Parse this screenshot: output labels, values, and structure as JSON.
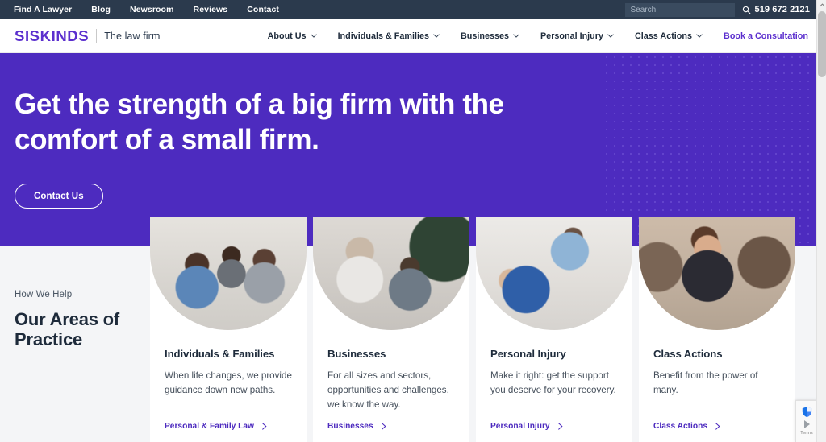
{
  "topbar": {
    "links": [
      {
        "label": "Find A Lawyer",
        "active": false
      },
      {
        "label": "Blog",
        "active": false
      },
      {
        "label": "Newsroom",
        "active": false
      },
      {
        "label": "Reviews",
        "active": true
      },
      {
        "label": "Contact",
        "active": false
      }
    ],
    "search_placeholder": "Search",
    "search_value": "",
    "phone": "519 672 2121",
    "bg_color": "#2b3a4d"
  },
  "header": {
    "logo_mark": "SISKINDS",
    "logo_tagline": "The law firm",
    "nav": [
      {
        "label": "About Us",
        "has_dropdown": true
      },
      {
        "label": "Individuals & Families",
        "has_dropdown": true
      },
      {
        "label": "Businesses",
        "has_dropdown": true
      },
      {
        "label": "Personal Injury",
        "has_dropdown": true
      },
      {
        "label": "Class Actions",
        "has_dropdown": true
      }
    ],
    "cta_label": "Book a Consultation",
    "accent_color": "#5b2fce"
  },
  "hero": {
    "title": "Get the strength of a big firm with the comfort of a small firm.",
    "button_label": "Contact Us",
    "bg_color": "#4d2bbf"
  },
  "practice": {
    "eyebrow": "How We Help",
    "title": "Our Areas of Practice",
    "cards": [
      {
        "title": "Individuals & Families",
        "description": "When life changes, we provide guidance down new paths.",
        "link_label": "Personal & Family Law",
        "image_alt": "three colleagues looking at a laptop at a table"
      },
      {
        "title": "Businesses",
        "description": "For all sizes and sectors, opportunities and challenges, we know the way.",
        "link_label": "Businesses",
        "image_alt": "woman presenting to colleagues in a meeting room"
      },
      {
        "title": "Personal Injury",
        "description": "Make it right: get the support you deserve for your recovery.",
        "link_label": "Personal Injury",
        "image_alt": "physiotherapist treating a patient's leg"
      },
      {
        "title": "Class Actions",
        "description": "Benefit from the power of many.",
        "link_label": "Class Actions",
        "image_alt": "lawyer in a courtroom holding documents"
      }
    ]
  },
  "recaptcha": {
    "terms_label": "Terms"
  }
}
